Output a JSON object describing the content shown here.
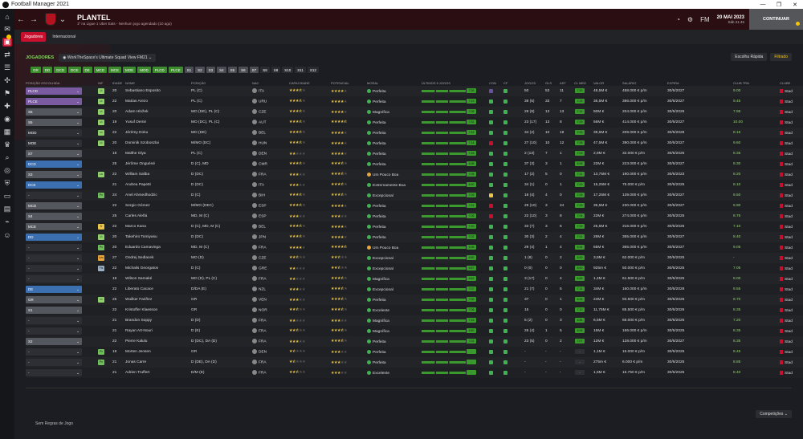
{
  "window": {
    "title": "Football Manager 2021"
  },
  "header": {
    "team_name": "PLANTEL",
    "subtitle": "1º na Ligue 1 Uber Eats - Nenhum jogo agendado (10 ago)",
    "date": "20 MAI 2023",
    "time": "Sáb 21:45",
    "continue_label": "CONTINUAR",
    "fm_label": "FM"
  },
  "subnav": {
    "tab_active": "Jogadores",
    "tab_other": "Internacional"
  },
  "filters": {
    "section_label": "JOGADORES",
    "view_name": "WorkTheSpace's Ultimate Squad View FM21",
    "quick_pick": "Escolha Rápida",
    "filtered": "Filtrado"
  },
  "chips": [
    {
      "label": "GR",
      "style": "g"
    },
    {
      "label": "DD",
      "style": "g"
    },
    {
      "label": "DCD",
      "style": "g"
    },
    {
      "label": "DCE",
      "style": "g"
    },
    {
      "label": "DE",
      "style": "g"
    },
    {
      "label": "MCD",
      "style": "g"
    },
    {
      "label": "MCE",
      "style": "g"
    },
    {
      "label": "MOE",
      "style": "g"
    },
    {
      "label": "MOD",
      "style": "g"
    },
    {
      "label": "PLCD",
      "style": "g"
    },
    {
      "label": "PLCE",
      "style": "g"
    },
    {
      "label": "S1",
      "style": "gr"
    },
    {
      "label": "S2",
      "style": "gr"
    },
    {
      "label": "S3",
      "style": "gr"
    },
    {
      "label": "S4",
      "style": "gr"
    },
    {
      "label": "S5",
      "style": "gr"
    },
    {
      "label": "S6",
      "style": "gr"
    },
    {
      "label": "S7",
      "style": "gr"
    },
    {
      "label": "S8",
      "style": "d"
    },
    {
      "label": "S9",
      "style": "d"
    },
    {
      "label": "S10",
      "style": "d"
    },
    {
      "label": "S11",
      "style": "d"
    },
    {
      "label": "S12",
      "style": "d"
    }
  ],
  "columns": [
    "POSIÇÃO ESCOLHIDA",
    "INF",
    "IDADE",
    "NOME",
    "POSIÇÃO",
    "NAC",
    "CAPACIDADE",
    "POTENCIAL",
    "MORAL",
    "ÚLTIMOS 5 JOGOS",
    "CON",
    "CF",
    "JOGOS",
    "GLS",
    "AST",
    "CL MED",
    "VALOR",
    "SALÁRIO",
    "EXPIRA",
    "CLUB TRN",
    "CLUBE"
  ],
  "players": [
    {
      "sel": "PLCD",
      "selc": "purple",
      "inf": "Lt",
      "age": "20",
      "name": "Sebastiano Esposito",
      "pos": "PL (C)",
      "nat": "ITA",
      "cap": 3.5,
      "pot": 4,
      "moral": "Perfeita",
      "mc": "#3fb34f",
      "form": "7.26",
      "con": "#6b4fa0",
      "jogos": "50",
      "gls": "53",
      "ast": "11",
      "cl": "7.30",
      "val": "48,5M €",
      "sal": "458.000 € p/m",
      "exp": "30/6/2027",
      "trn": "9.00",
      "club": "Stad"
    },
    {
      "sel": "PLCE",
      "selc": "purple",
      "inf": "Lt",
      "age": "22",
      "name": "Matías Arezo",
      "pos": "PL (C)",
      "nat": "URU",
      "cap": 3.5,
      "pot": 4,
      "moral": "Perfeita",
      "mc": "#3fb34f",
      "form": "7.19",
      "con": "#3fb34f",
      "jogos": "38 (5)",
      "gls": "33",
      "ast": "7",
      "cl": "7.23",
      "val": "36,5M €",
      "sal": "386.000 € p/m",
      "exp": "30/6/2027",
      "trn": "9.45",
      "club": "Stad"
    },
    {
      "sel": "S6",
      "selc": "grey",
      "inf": "Lt",
      "age": "20",
      "name": "Adam Hložek",
      "pos": "MO (DE), PL (C)",
      "nat": "CZE",
      "cap": 3.5,
      "pot": 4,
      "moral": "Magnífica",
      "mc": "#3fb34f",
      "form": "7.05",
      "con": "#3fb34f",
      "jogos": "29 (8)",
      "gls": "13",
      "ast": "13",
      "cl": "7.12",
      "val": "50M €",
      "sal": "204.000 € p/m",
      "exp": "30/6/2026",
      "trn": "7.95",
      "club": "Stad"
    },
    {
      "sel": "S5",
      "selc": "grey",
      "inf": "Lt",
      "age": "19",
      "name": "Yusuf Demir",
      "pos": "MO (DC), PL (C)",
      "nat": "AUT",
      "cap": 3.5,
      "pot": 4.5,
      "moral": "Perfeita",
      "mc": "#3fb34f",
      "form": "7.31",
      "con": "#3fb34f",
      "jogos": "23 (17)",
      "gls": "13",
      "ast": "8",
      "cl": "7.09",
      "val": "56M €",
      "sal": "414.000 € p/m",
      "exp": "30/6/2027",
      "trn": "10.00",
      "club": "Stad"
    },
    {
      "sel": "MOD",
      "selc": "dark",
      "inf": "Lt",
      "age": "22",
      "name": "Jérémy Doku",
      "pos": "MO (DE)",
      "nat": "BEL",
      "cap": 3.5,
      "pot": 4,
      "moral": "Perfeita",
      "mc": "#3fb34f",
      "form": "7.22",
      "con": "#3fb34f",
      "jogos": "34 (2)",
      "gls": "10",
      "ast": "19",
      "cl": "7.23",
      "val": "39,5M €",
      "sal": "209.000 € p/m",
      "exp": "30/6/2028",
      "trn": "8.15",
      "club": "Stad"
    },
    {
      "sel": "MOE",
      "selc": "dark",
      "inf": "Lt",
      "age": "20",
      "name": "Dominik Szoboszlai",
      "pos": "M/MO (EC)",
      "nat": "HUN",
      "cap": 3.5,
      "pot": 4,
      "moral": "Perfeita",
      "mc": "#3fb34f",
      "form": "7.14",
      "con": "#c8102e",
      "jogos": "27 (10)",
      "gls": "10",
      "ast": "12",
      "cl": "7.08",
      "val": "47,5M €",
      "sal": "390.000 € p/m",
      "exp": "30/6/2027",
      "trn": "9.60",
      "club": "Stad"
    },
    {
      "sel": "S7",
      "selc": "grey",
      "inf": "",
      "age": "18",
      "name": "Malthe Glya",
      "pos": "PL (C)",
      "nat": "DEN",
      "cap": 2,
      "pot": 4,
      "moral": "Perfeita",
      "mc": "#3fb34f",
      "form": "7.28",
      "con": "#3fb34f",
      "jogos": "2 (13)",
      "gls": "7",
      "ast": "1",
      "cl": "7.03",
      "val": "2,8M €",
      "sal": "32.000 € p/m",
      "exp": "30/6/2025",
      "trn": "8.35",
      "club": "Stad"
    },
    {
      "sel": "DCD",
      "selc": "blue",
      "inf": "",
      "age": "25",
      "name": "Jérôme Onguéné",
      "pos": "D (C), MD",
      "nat": "CMR",
      "cap": 3.5,
      "pot": 3.5,
      "moral": "Perfeita",
      "mc": "#3fb34f",
      "form": "6.98",
      "con": "#3fb34f",
      "jogos": "37 (3)",
      "gls": "3",
      "ast": "1",
      "cl": "6.98",
      "val": "22M €",
      "sal": "223.000 € p/m",
      "exp": "30/6/2027",
      "trn": "8.30",
      "club": "Stad"
    },
    {
      "sel": "S3",
      "selc": "grey",
      "inf": "Ls",
      "age": "22",
      "name": "William Saliba",
      "pos": "D (DC)",
      "nat": "FRA",
      "cap": 3,
      "pot": 3.5,
      "moral": "Um Pouco Boa",
      "mc": "#e9a63a",
      "form": "7.05",
      "con": "#3fb34f",
      "jogos": "17 (2)",
      "gls": "5",
      "ast": "0",
      "cl": "7.11",
      "val": "13,75M €",
      "sal": "190.000 € p/m",
      "exp": "30/6/2023",
      "trn": "8.20",
      "club": "Stad"
    },
    {
      "sel": "DCE",
      "selc": "blue",
      "inf": "",
      "age": "21",
      "name": "Andrea Papetti",
      "pos": "D (DC)",
      "nat": "ITA",
      "cap": 3,
      "pot": 3.5,
      "moral": "Extremamente Boa",
      "mc": "#3fb34f",
      "form": "6.90",
      "con": "#3fb34f",
      "jogos": "34 (1)",
      "gls": "0",
      "ast": "1",
      "cl": "7.00",
      "val": "15,25M €",
      "sal": "75.000 € p/m",
      "exp": "30/6/2025",
      "trn": "8.10",
      "club": "Stad"
    },
    {
      "sel": "-",
      "selc": "dark",
      "inf": "Pv",
      "age": "24",
      "name": "Anel Ahmedhodzic",
      "pos": "D (C)",
      "nat": "BIH",
      "cap": 3.5,
      "pot": 3.5,
      "moral": "Excepcional",
      "mc": "#3fb34f",
      "form": "7.03",
      "con": "#e9c54a",
      "jogos": "18 (4)",
      "gls": "4",
      "ast": "0",
      "cl": "7.05",
      "val": "17,25M €",
      "sal": "139.000 € p/m",
      "exp": "30/6/2027",
      "trn": "8.50",
      "club": "Stad"
    },
    {
      "sel": "MCD",
      "selc": "grey",
      "inf": "",
      "age": "22",
      "name": "Sergio Gómez",
      "pos": "M/MO (DEC)",
      "nat": "ESP",
      "cap": 3.5,
      "pot": 4,
      "moral": "Perfeita",
      "mc": "#3fb34f",
      "form": "7.21",
      "con": "#c8102e",
      "jogos": "29 (10)",
      "gls": "3",
      "ast": "24",
      "cl": "7.09",
      "val": "36,5M €",
      "sal": "230.000 € p/m",
      "exp": "30/6/2027",
      "trn": "8.90",
      "club": "Stad"
    },
    {
      "sel": "S4",
      "selc": "grey",
      "inf": "",
      "age": "25",
      "name": "Carles Aleñá",
      "pos": "MD, M (C)",
      "nat": "ESP",
      "cap": 3,
      "pot": 3,
      "moral": "Perfeita",
      "mc": "#3fb34f",
      "form": "7.05",
      "con": "#c8102e",
      "jogos": "22 (10)",
      "gls": "3",
      "ast": "8",
      "cl": "7.04",
      "val": "22M €",
      "sal": "274.000 € p/m",
      "exp": "30/6/2025",
      "trn": "8.75",
      "club": "Stad"
    },
    {
      "sel": "MCE",
      "selc": "grey",
      "inf": "Tr",
      "age": "22",
      "name": "Marco Kana",
      "pos": "D (C), MD, M (C)",
      "nat": "BEL",
      "cap": 3.5,
      "pot": 4,
      "moral": "Perfeita",
      "mc": "#3fb34f",
      "form": "7.20",
      "con": "#3fb34f",
      "jogos": "33 (7)",
      "gls": "3",
      "ast": "6",
      "cl": "7.09",
      "val": "25,5M €",
      "sal": "316.000 € p/m",
      "exp": "30/6/2026",
      "trn": "7.10",
      "club": "Stad"
    },
    {
      "sel": "DD",
      "selc": "blue",
      "inf": "Lt",
      "age": "20",
      "name": "Takehiro Tomiyasu",
      "pos": "D (DC)",
      "nat": "JPN",
      "cap": 3.5,
      "pot": 4,
      "moral": "Perfeita",
      "mc": "#3fb34f",
      "form": "7.02",
      "con": "#3fb34f",
      "jogos": "30 (3)",
      "gls": "2",
      "ast": "4",
      "cl": "7.01",
      "val": "26M €",
      "sal": "355.000 € p/m",
      "exp": "30/6/2027",
      "trn": "8.40",
      "club": "Stad"
    },
    {
      "sel": "-",
      "selc": "dark",
      "inf": "Pv",
      "age": "20",
      "name": "Eduardo Camavinga",
      "pos": "MD, M (C)",
      "nat": "FRA",
      "cap": 4,
      "pot": 4.5,
      "moral": "Um Pouco Boa",
      "mc": "#e9a63a",
      "form": "6.95",
      "con": "#3fb34f",
      "jogos": "29 (4)",
      "gls": "1",
      "ast": "4",
      "cl": "6.94",
      "val": "65M €",
      "sal": "365.000 € p/m",
      "exp": "30/6/2027",
      "trn": "9.05",
      "club": "Stad"
    },
    {
      "sel": "-",
      "selc": "dark",
      "inf": "Les",
      "age": "27",
      "name": "Ondrej Sedlacek",
      "pos": "MO (D)",
      "nat": "CZE",
      "cap": 2.5,
      "pot": 2.5,
      "moral": "Excepcional",
      "mc": "#3fb34f",
      "form": "6.80",
      "con": "#3fb34f",
      "jogos": "1 (8)",
      "gls": "0",
      "ast": "2",
      "cl": "6.90",
      "val": "3,9M €",
      "sal": "62.000 € p/m",
      "exp": "30/6/2025",
      "trn": "-",
      "club": "Stad"
    },
    {
      "sel": "-",
      "selc": "dark",
      "inf": "Fis",
      "age": "22",
      "name": "Michalis Georgatos",
      "pos": "D (C)",
      "nat": "GRE",
      "cap": 2,
      "pot": 2.5,
      "moral": "Excepcional",
      "mc": "#3fb34f",
      "form": "6.87",
      "con": "#3fb34f",
      "jogos": "0 (0)",
      "gls": "0",
      "ast": "0",
      "cl": "6.60",
      "val": "925m €",
      "sal": "50.000 € p/m",
      "exp": "30/6/2025",
      "trn": "7.05",
      "club": "Stad"
    },
    {
      "sel": "-",
      "selc": "dark",
      "inf": "",
      "age": "19",
      "name": "Wilson Samaké",
      "pos": "MO (D), PL (C)",
      "nat": "FRA",
      "cap": 2,
      "pot": 3.5,
      "moral": "Magnífica",
      "mc": "#3fb34f",
      "form": "6.62",
      "con": "#3fb34f",
      "jogos": "3 (17)",
      "gls": "0",
      "ast": "4",
      "cl": "6.65",
      "val": "1,4M €",
      "sal": "61.500 € p/m",
      "exp": "30/6/2025",
      "trn": "8.00",
      "club": "Stad"
    },
    {
      "sel": "DE",
      "selc": "blue",
      "inf": "",
      "age": "22",
      "name": "Liberato Cacace",
      "pos": "D/DA (E)",
      "nat": "NZL",
      "cap": 3,
      "pot": 3.5,
      "moral": "Excepcional",
      "mc": "#3fb34f",
      "form": "7.07",
      "con": "#3fb34f",
      "jogos": "21 (7)",
      "gls": "0",
      "ast": "5",
      "cl": "7.16",
      "val": "34M €",
      "sal": "160.000 € p/m",
      "exp": "30/6/2028",
      "trn": "8.55",
      "club": "Stad"
    },
    {
      "sel": "GR",
      "selc": "grey",
      "inf": "Lt",
      "age": "25",
      "name": "Wuilker Fariñez",
      "pos": "GR",
      "nat": "VEN",
      "cap": 3,
      "pot": 3.5,
      "moral": "Perfeita",
      "mc": "#3fb34f",
      "form": "7.00",
      "con": "#3fb34f",
      "jogos": "37",
      "gls": "0",
      "ast": "1",
      "cl": "6.96",
      "val": "24M €",
      "sal": "93.500 € p/m",
      "exp": "30/6/2026",
      "trn": "8.70",
      "club": "Stad"
    },
    {
      "sel": "S1",
      "selc": "grey",
      "inf": "",
      "age": "22",
      "name": "Kristoffer Klaesson",
      "pos": "GR",
      "nat": "NOR",
      "cap": 2.5,
      "pot": 3.5,
      "moral": "Excelente",
      "mc": "#3fb34f",
      "form": "7.06",
      "con": "#3fb34f",
      "jogos": "15",
      "gls": "0",
      "ast": "0",
      "cl": "7.10",
      "val": "11,75M €",
      "sal": "85.500 € p/m",
      "exp": "30/6/2026",
      "trn": "8.35",
      "club": "Stad"
    },
    {
      "sel": "-",
      "selc": "dark",
      "inf": "",
      "age": "21",
      "name": "Brandon Soppy",
      "pos": "D (D)",
      "nat": "FRA",
      "cap": 2,
      "pot": 3,
      "moral": "Magnífica",
      "mc": "#3fb34f",
      "form": "7.15",
      "con": "#3fb34f",
      "jogos": "5 (2)",
      "gls": "0",
      "ast": "3",
      "cl": "6.86",
      "val": "6,5M €",
      "sal": "66.000 € p/m",
      "exp": "30/6/2025",
      "trn": "7.20",
      "club": "Stad"
    },
    {
      "sel": "-",
      "selc": "dark",
      "inf": "",
      "age": "21",
      "name": "Rayan Aït-Nouri",
      "pos": "D (E)",
      "nat": "FRA",
      "cap": 2.5,
      "pot": 3.5,
      "moral": "Magnífica",
      "mc": "#3fb34f",
      "form": "6.80",
      "con": "#3fb34f",
      "jogos": "25 (4)",
      "gls": "1",
      "ast": "5",
      "cl": "6.95",
      "val": "15M €",
      "sal": "166.000 € p/m",
      "exp": "30/6/2025",
      "trn": "8.35",
      "club": "Stad"
    },
    {
      "sel": "S2",
      "selc": "grey",
      "inf": "",
      "age": "22",
      "name": "Pierre Kalulu",
      "pos": "D (DC), DA (D)",
      "nat": "FRA",
      "cap": 3,
      "pot": 3.5,
      "moral": "Perfeita",
      "mc": "#3fb34f",
      "form": "7.02",
      "con": "#3fb34f",
      "jogos": "23 (5)",
      "gls": "0",
      "ast": "2",
      "cl": "7.07",
      "val": "12M €",
      "sal": "128.000 € p/m",
      "exp": "30/6/2027",
      "trn": "8.35",
      "club": "Stad"
    },
    {
      "sel": "-",
      "selc": "dark",
      "inf": "Pv",
      "age": "18",
      "name": "Morten Jensen",
      "pos": "GR",
      "nat": "DEN",
      "cap": 1.5,
      "pot": 3,
      "moral": "Perfeita",
      "mc": "#3fb34f",
      "form": "-",
      "con": "#3fb34f",
      "jogos": "-",
      "gls": "-",
      "ast": "-",
      "cl": "-",
      "val": "1,1M €",
      "sal": "15.000 € p/m",
      "exp": "30/6/2025",
      "trn": "8.45",
      "club": "Stad"
    },
    {
      "sel": "-",
      "selc": "dark",
      "inf": "Pv",
      "age": "21",
      "name": "Jonas Carre",
      "pos": "D (DE), DA (D)",
      "nat": "FRA",
      "cap": 1.5,
      "pot": 3,
      "moral": "Perfeita",
      "mc": "#3fb34f",
      "form": "-",
      "con": "#3fb34f",
      "jogos": "-",
      "gls": "-",
      "ast": "-",
      "cl": "-",
      "val": "275m €",
      "sal": "6.000 € p/m",
      "exp": "30/6/2025",
      "trn": "8.85",
      "club": "Stad"
    },
    {
      "sel": "-",
      "selc": "dark",
      "inf": "",
      "age": "21",
      "name": "Adrien Truffert",
      "pos": "D/M (E)",
      "nat": "FRA",
      "cap": 2.5,
      "pot": 3,
      "moral": "Excelente",
      "mc": "#3fb34f",
      "form": "-",
      "con": "#3fb34f",
      "jogos": "-",
      "gls": "-",
      "ast": "-",
      "cl": "-",
      "val": "1,5M €",
      "sal": "15.750 € p/m",
      "exp": "30/6/2025",
      "trn": "8.40",
      "club": "Stad"
    }
  ],
  "footer": {
    "rules": "Sem Regras de Jogo",
    "competitions": "Competições"
  }
}
